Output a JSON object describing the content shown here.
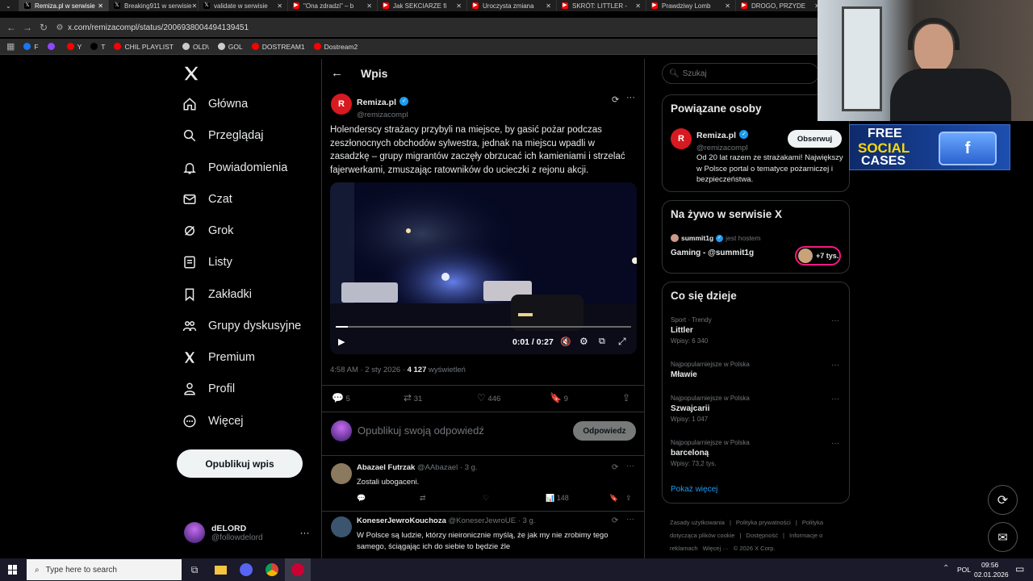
{
  "browser": {
    "tabs": [
      {
        "label": "Remiza.pl w serwisie",
        "color": "#000000",
        "active": true
      },
      {
        "label": "Breaking911 w serwisie",
        "color": "#000000",
        "active": false
      },
      {
        "label": "validate w serwisie",
        "color": "#000000",
        "active": false
      },
      {
        "label": "\"Ona zdradzi\" – b",
        "color": "#ff0000",
        "active": false
      },
      {
        "label": "Jak SEKCIARZE fi",
        "color": "#ff0000",
        "active": false
      },
      {
        "label": "Uroczysta zmiana",
        "color": "#ff0000",
        "active": false
      },
      {
        "label": "SKRÓT: LITTLER -",
        "color": "#ff0000",
        "active": false
      },
      {
        "label": "Prawdziwy Lomb",
        "color": "#ff0000",
        "active": false
      },
      {
        "label": "DROGO, PRZYDE",
        "color": "#ff0000",
        "active": false
      }
    ],
    "url": "x.com/remizacompl/status/2006938004494139451",
    "bookmarks": [
      {
        "label": "F",
        "color": "#1877f2"
      },
      {
        "label": "",
        "color": "#9146ff"
      },
      {
        "label": "Y",
        "color": "#ff0000"
      },
      {
        "label": "T",
        "color": "#000000"
      },
      {
        "label": "CHIL PLAYLIST",
        "color": "#ff0000"
      },
      {
        "label": "OLD\\",
        "color": "#cccccc"
      },
      {
        "label": "GOL",
        "color": "#cccccc"
      },
      {
        "label": "DOSTREAM1",
        "color": "#ff0000"
      },
      {
        "label": "Dostream2",
        "color": "#ff0000"
      }
    ]
  },
  "nav": {
    "items": [
      {
        "label": "Główna",
        "icon": "home-icon"
      },
      {
        "label": "Przeglądaj",
        "icon": "search-icon"
      },
      {
        "label": "Powiadomienia",
        "icon": "bell-icon"
      },
      {
        "label": "Czat",
        "icon": "mail-icon"
      },
      {
        "label": "Grok",
        "icon": "grok-icon"
      },
      {
        "label": "Listy",
        "icon": "list-icon"
      },
      {
        "label": "Zakładki",
        "icon": "bookmark-icon"
      },
      {
        "label": "Grupy dyskusyjne",
        "icon": "people-icon"
      },
      {
        "label": "Premium",
        "icon": "x-icon"
      },
      {
        "label": "Profil",
        "icon": "person-icon"
      },
      {
        "label": "Więcej",
        "icon": "more-circle-icon"
      }
    ],
    "post_button": "Opublikuj wpis",
    "account": {
      "name": "dELORD",
      "handle": "@followdelord"
    }
  },
  "post": {
    "header": "Wpis",
    "author": {
      "name": "Remiza.pl",
      "handle": "@remizacompl"
    },
    "text": "Holenderscy strażacy przybyli na miejsce, by gasić pożar podczas zeszłonocnych obchodów sylwestra, jednak na miejscu wpadli w zasadzkę – grupy migrantów zaczęły obrzucać ich kamieniami i strzelać fajerwerkami, zmuszając ratowników do ucieczki z rejonu akcji.",
    "video": {
      "time": "0:01 / 0:27",
      "progress": 0.04
    },
    "meta": {
      "time": "4:58 AM · 2 sty 2026 · ",
      "views": "4 127",
      "views_label": " wyświetleń"
    },
    "stats": {
      "replies": "5",
      "reposts": "31",
      "likes": "446",
      "bookmarks": "9"
    },
    "reply_placeholder": "Opublikuj swoją odpowiedź",
    "reply_button": "Odpowiedz"
  },
  "replies": [
    {
      "name": "Abazael Futrzak",
      "handle": "@AAbazael · 3 g.",
      "text": "Zostali ubogaceni.",
      "views": "148"
    },
    {
      "name": "KoneserJewroKouchoza",
      "handle": "@KoneserJewroUE · 3 g.",
      "text": "W Polsce są ludzie, którzy nieironicznie myślą, że jak my nie zrobimy tego samego, ściągając ich do siebie to będzie źle"
    }
  ],
  "sidebar": {
    "search_placeholder": "Szukaj",
    "related": {
      "title": "Powiązane osoby",
      "name": "Remiza.pl",
      "handle": "@remizacompl",
      "follow": "Obserwuj",
      "bio": "Od 20 lat razem ze strażakami! Największy w Polsce portal o tematyce pożarniczej i bezpieczeństwa."
    },
    "live": {
      "title": "Na żywo w serwisie X",
      "host": "summit1g",
      "host_suffix": "jest hostem",
      "stream": "Gaming - @summit1g",
      "badge": "+7 tys."
    },
    "trends": {
      "title": "Co się dzieje",
      "items": [
        {
          "category": "Sport · Trendy",
          "topic": "Littler",
          "count": "Wpisy: 6 340"
        },
        {
          "category": "Najpopularniejsze w Polska",
          "topic": "Mławie",
          "count": ""
        },
        {
          "category": "Najpopularniejsze w Polska",
          "topic": "Szwajcarii",
          "count": "Wpisy: 1 047"
        },
        {
          "category": "Najpopularniejsze w Polska",
          "topic": "barceloną",
          "count": "Wpisy: 73,2 tys."
        }
      ],
      "more": "Pokaż więcej"
    },
    "footer": [
      "Zasady użytkowania",
      "|",
      "Polityka prywatności",
      "|",
      "Polityka dotycząca plików cookie",
      "|",
      "Dostępność",
      "|",
      "Informacje o reklamach",
      "Więcej ···",
      "© 2026 X Corp."
    ]
  },
  "overlay": {
    "banner_line1": "FREE",
    "banner_line2": "SOCIAL",
    "banner_line3": "CASES"
  },
  "taskbar": {
    "search": "Type here to search",
    "lang": "POL",
    "time": "09:56",
    "date": "02.01.2026"
  }
}
